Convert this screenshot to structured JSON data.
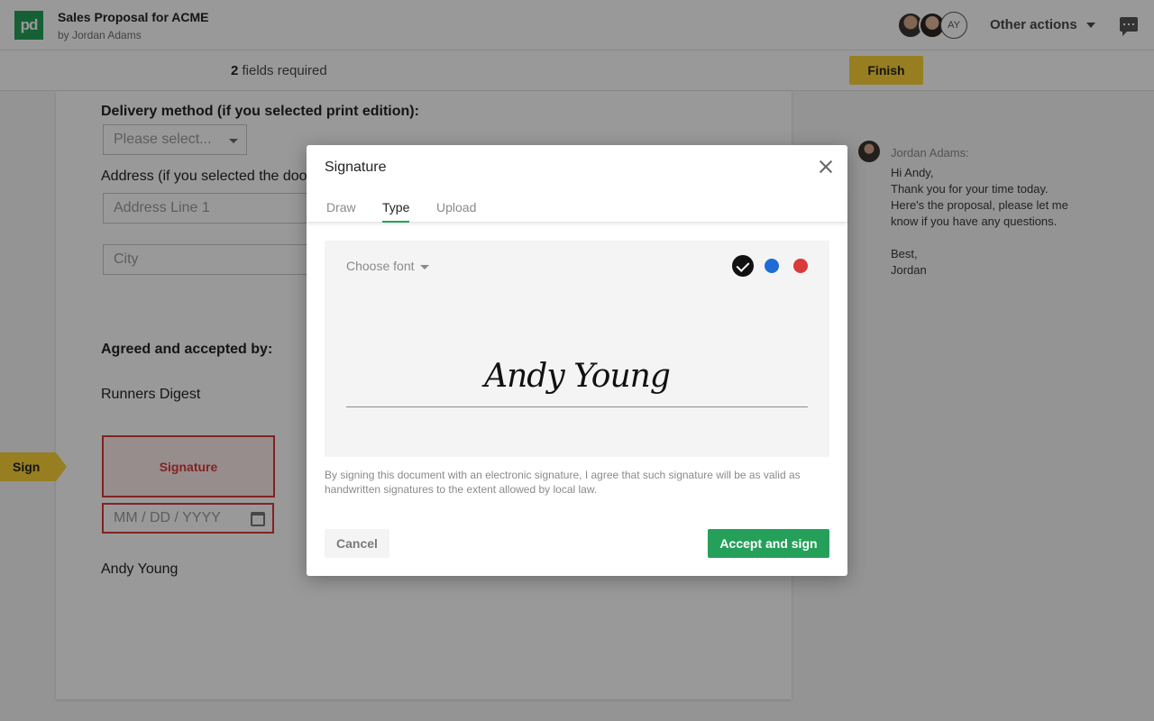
{
  "header": {
    "logo_text": "pd",
    "title": "Sales Proposal for ACME",
    "author": "by Jordan Adams",
    "avatar_initials": "AY",
    "other_actions_label": "Other actions"
  },
  "subbar": {
    "fields_count": "2",
    "fields_label": " fields required",
    "finish_label": "Finish"
  },
  "document": {
    "delivery_label": "Delivery method (if you selected print edition):",
    "delivery_placeholder": "Please select...",
    "address_label": "Address (if you selected the door delivery):",
    "address_line1_placeholder": "Address Line 1",
    "city_placeholder": "City",
    "agreed_label": "Agreed and accepted by:",
    "company": "Runners Digest",
    "signature_field_label": "Signature",
    "date_placeholder": "MM / DD / YYYY",
    "signer_name": "Andy Young",
    "sign_tag": "Sign"
  },
  "comment": {
    "author": "Jordan Adams:",
    "lines": [
      "Hi Andy,",
      "Thank you for your time today.",
      "Here's the proposal, please let me know if you have any questions.",
      "",
      "Best,",
      "Jordan"
    ]
  },
  "modal": {
    "title": "Signature",
    "tabs": [
      "Draw",
      "Type",
      "Upload"
    ],
    "active_tab": "Type",
    "choose_font_label": "Choose font",
    "colors": [
      "#111111",
      "#1f6bd6",
      "#d93a3a"
    ],
    "signature_text": "Andy Young",
    "legal_text": "By signing this document with an electronic signature, I agree that such signature will be as valid as handwritten signatures to the extent allowed by local law.",
    "cancel_label": "Cancel",
    "accept_label": "Accept and sign"
  }
}
